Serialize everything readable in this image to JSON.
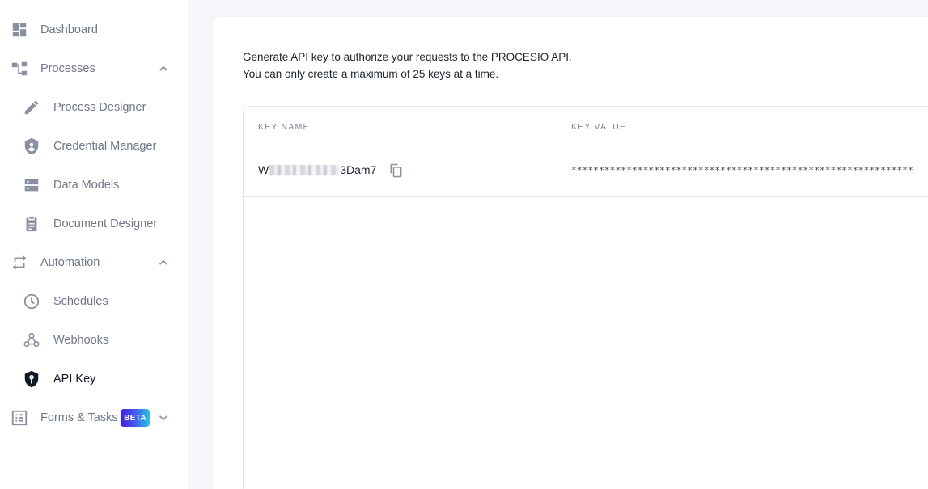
{
  "sidebar": {
    "items": [
      {
        "label": "Dashboard",
        "icon": "dashboard-icon"
      },
      {
        "label": "Processes",
        "icon": "processes-icon",
        "expanded": true
      },
      {
        "label": "Process Designer",
        "icon": "pencil-icon"
      },
      {
        "label": "Credential Manager",
        "icon": "shield-icon"
      },
      {
        "label": "Data Models",
        "icon": "storage-icon"
      },
      {
        "label": "Document Designer",
        "icon": "clipboard-icon"
      },
      {
        "label": "Automation",
        "icon": "repeat-icon",
        "expanded": true
      },
      {
        "label": "Schedules",
        "icon": "clock-icon"
      },
      {
        "label": "Webhooks",
        "icon": "webhook-icon"
      },
      {
        "label": "API Key",
        "icon": "key-shield-icon",
        "active": true
      },
      {
        "label": "Forms & Tasks",
        "icon": "form-icon",
        "expanded": false,
        "badge": "BETA"
      }
    ]
  },
  "main": {
    "intro_line1": "Generate API key to authorize your requests to the PROCESIO API.",
    "intro_line2": "You can only create a maximum of 25 keys at a time.",
    "table": {
      "headers": [
        "KEY NAME",
        "KEY VALUE"
      ],
      "rows": [
        {
          "name_prefix": "W",
          "name_suffix": "3Dam7",
          "value": "**************************************************************"
        }
      ]
    }
  },
  "colors": {
    "sidebar_bg": "#ffffff",
    "page_bg": "#f5f6fa",
    "icon_gray": "#8a90a0",
    "active_dark": "#121826",
    "beta_gradient_start": "#3f1fd8",
    "beta_gradient_end": "#22c7e6"
  }
}
